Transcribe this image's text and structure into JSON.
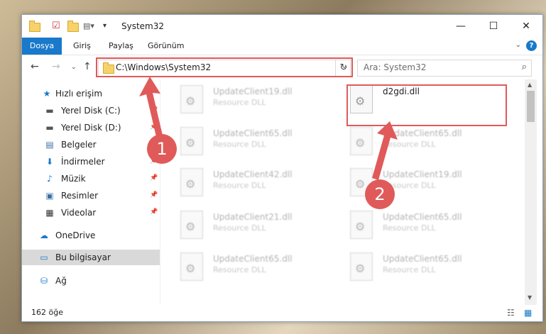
{
  "window": {
    "title": "System32"
  },
  "menu": {
    "file": "Dosya",
    "home": "Giriş",
    "share": "Paylaş",
    "view": "Görünüm",
    "help": "?"
  },
  "address": {
    "path": "C:\\Windows\\System32"
  },
  "search": {
    "placeholder": "Ara: System32"
  },
  "sidebar": {
    "items": [
      {
        "label": "Hızlı erişim",
        "icon": "star-icon"
      },
      {
        "label": "Yerel Disk (C:)",
        "icon": "drive-icon"
      },
      {
        "label": "Yerel Disk (D:)",
        "icon": "drive-icon"
      },
      {
        "label": "Belgeler",
        "icon": "document-icon"
      },
      {
        "label": "İndirmeler",
        "icon": "download-icon"
      },
      {
        "label": "Müzik",
        "icon": "music-icon"
      },
      {
        "label": "Resimler",
        "icon": "pictures-icon"
      },
      {
        "label": "Videolar",
        "icon": "video-icon"
      },
      {
        "label": "OneDrive",
        "icon": "cloud-icon"
      },
      {
        "label": "Bu bilgisayar",
        "icon": "computer-icon"
      },
      {
        "label": "Ağ",
        "icon": "network-icon"
      }
    ]
  },
  "files": [
    {
      "name": "UpdateClient19.dll",
      "type": "Resource DLL"
    },
    {
      "name": "d2gdi.dll",
      "type": ""
    },
    {
      "name": "UpdateClient65.dll",
      "type": "Resource DLL"
    },
    {
      "name": "UpdateClient65.dll",
      "type": "Resource DLL"
    },
    {
      "name": "UpdateClient42.dll",
      "type": "Resource DLL"
    },
    {
      "name": "UpdateClient19.dll",
      "type": "Resource DLL"
    },
    {
      "name": "UpdateClient21.dll",
      "type": "Resource DLL"
    },
    {
      "name": "UpdateClient65.dll",
      "type": "Resource DLL"
    },
    {
      "name": "UpdateClient65.dll",
      "type": "Resource DLL"
    },
    {
      "name": "UpdateClient65.dll",
      "type": "Resource DLL"
    }
  ],
  "status": {
    "count": "162 öğe"
  },
  "annotations": {
    "step1": "1",
    "step2": "2",
    "accent": "#e05a5a"
  }
}
